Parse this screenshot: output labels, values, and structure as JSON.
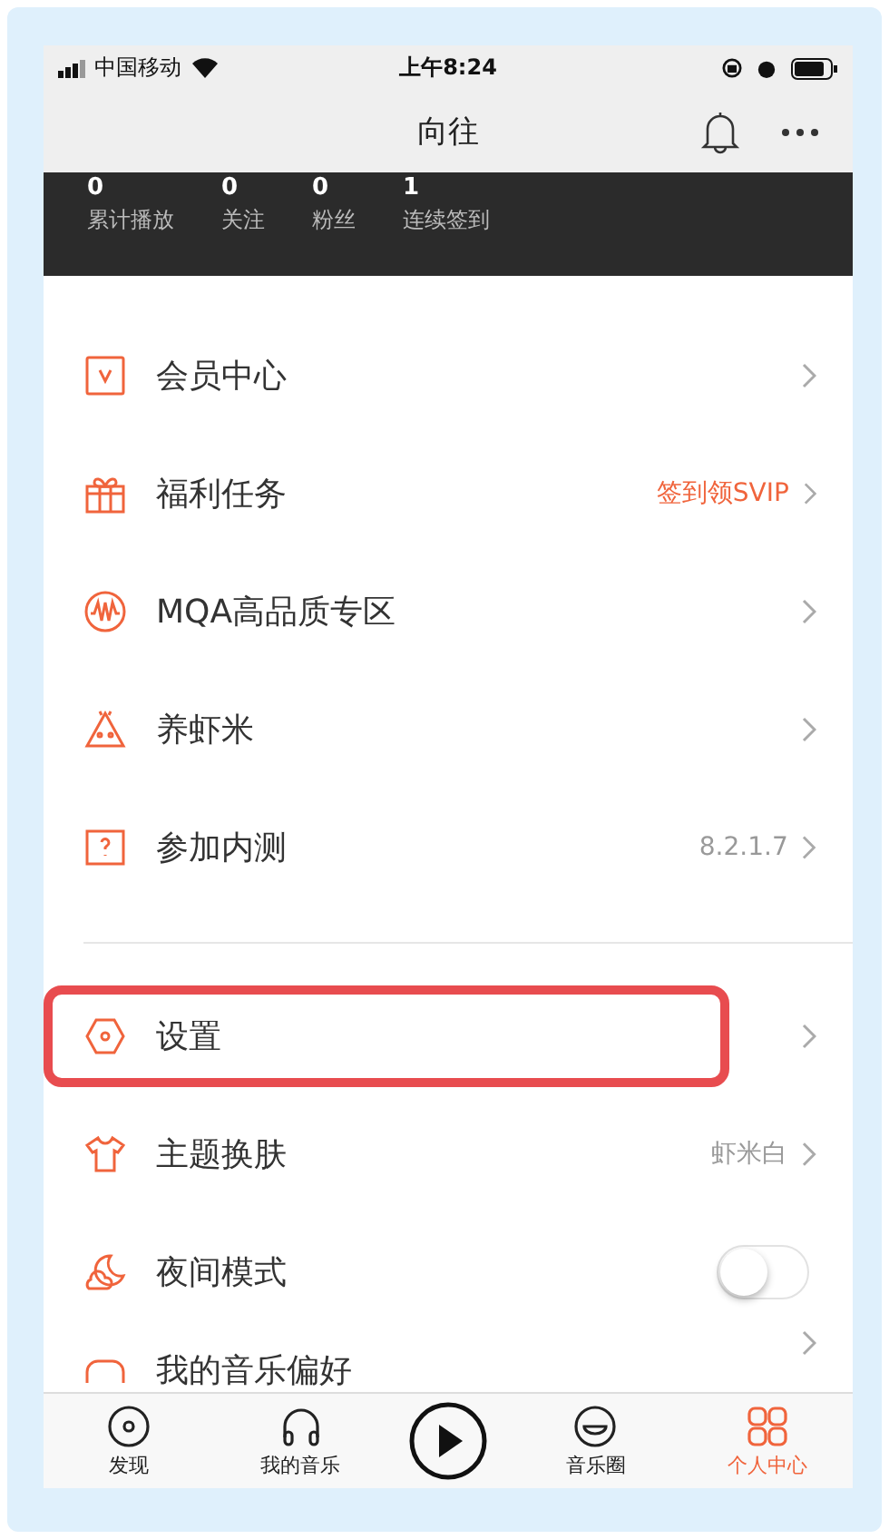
{
  "status_bar": {
    "carrier": "中国移动",
    "time": "上午8:24"
  },
  "nav": {
    "title": "向往"
  },
  "stats": [
    {
      "value": "0",
      "label": "累计播放"
    },
    {
      "value": "0",
      "label": "关注"
    },
    {
      "value": "0",
      "label": "粉丝"
    },
    {
      "value": "1",
      "label": "连续签到"
    }
  ],
  "sections": [
    [
      {
        "kind": "link",
        "label": "会员中心",
        "highlighted": false
      },
      {
        "kind": "link",
        "label": "福利任务",
        "value": "签到领SVIP",
        "value_accent": true,
        "highlighted": false
      },
      {
        "kind": "link",
        "label": "MQA高品质专区",
        "highlighted": false
      },
      {
        "kind": "link",
        "label": "养虾米",
        "highlighted": false
      },
      {
        "kind": "link",
        "label": "参加内测",
        "value": "8.2.1.7",
        "value_accent": false,
        "highlighted": false
      }
    ],
    [
      {
        "kind": "link",
        "label": "设置",
        "highlighted": true
      },
      {
        "kind": "link",
        "label": "主题换肤",
        "value": "虾米白",
        "value_accent": false,
        "highlighted": false
      },
      {
        "kind": "toggle",
        "label": "夜间模式",
        "on": false,
        "highlighted": false
      },
      {
        "kind": "link",
        "label": "我的音乐偏好",
        "highlighted": false
      }
    ]
  ],
  "tab_bar": [
    {
      "kind": "tab",
      "label": "发现",
      "selected": false
    },
    {
      "kind": "tab",
      "label": "我的音乐",
      "selected": false
    },
    {
      "kind": "play"
    },
    {
      "kind": "tab",
      "label": "音乐圈",
      "selected": false
    },
    {
      "kind": "tab",
      "label": "个人中心",
      "selected": true
    }
  ]
}
